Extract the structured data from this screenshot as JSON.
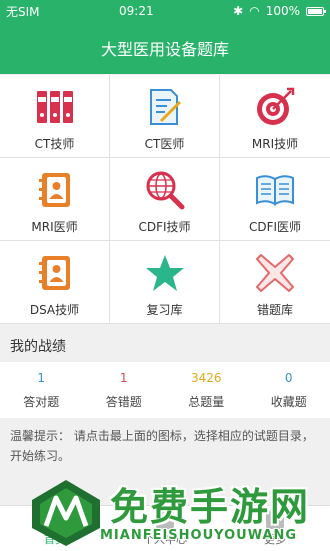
{
  "status_bar": {
    "carrier": "无SIM",
    "time": "09:21",
    "battery": "100%"
  },
  "header": {
    "title": "大型医用设备题库"
  },
  "grid_items": [
    {
      "label": "CT技师",
      "icon": "binders-icon"
    },
    {
      "label": "CT医师",
      "icon": "document-edit-icon"
    },
    {
      "label": "MRI技师",
      "icon": "target-icon"
    },
    {
      "label": "MRI医师",
      "icon": "contact-book-icon"
    },
    {
      "label": "CDFI技师",
      "icon": "globe-search-icon"
    },
    {
      "label": "CDFI医师",
      "icon": "open-book-icon"
    },
    {
      "label": "DSA技师",
      "icon": "contact-book-icon"
    },
    {
      "label": "复习库",
      "icon": "star-icon"
    },
    {
      "label": "错题库",
      "icon": "cross-icon"
    }
  ],
  "record": {
    "title": "我的战绩",
    "stats": [
      {
        "value": "1",
        "label": "答对题",
        "color": "#3a8fd6"
      },
      {
        "value": "1",
        "label": "答错题",
        "color": "#e0494a"
      },
      {
        "value": "3426",
        "label": "总题量",
        "color": "#e8a81c"
      },
      {
        "value": "0",
        "label": "收藏题",
        "color": "#3a8fd6"
      }
    ]
  },
  "tip": "温馨提示： 请点击最上面的图标，选择相应的试题目录，开始练习。",
  "tabs": [
    {
      "label": "首页"
    },
    {
      "label": "个人中心"
    },
    {
      "label": "更多"
    }
  ],
  "watermark": {
    "title": "免费手游网",
    "subtitle": "MIANFEISHOUYOUWANG"
  },
  "colors": {
    "primary": "#29b36a",
    "red": "#d7314d",
    "blue": "#3a8fd6",
    "orange": "#e8802a"
  }
}
